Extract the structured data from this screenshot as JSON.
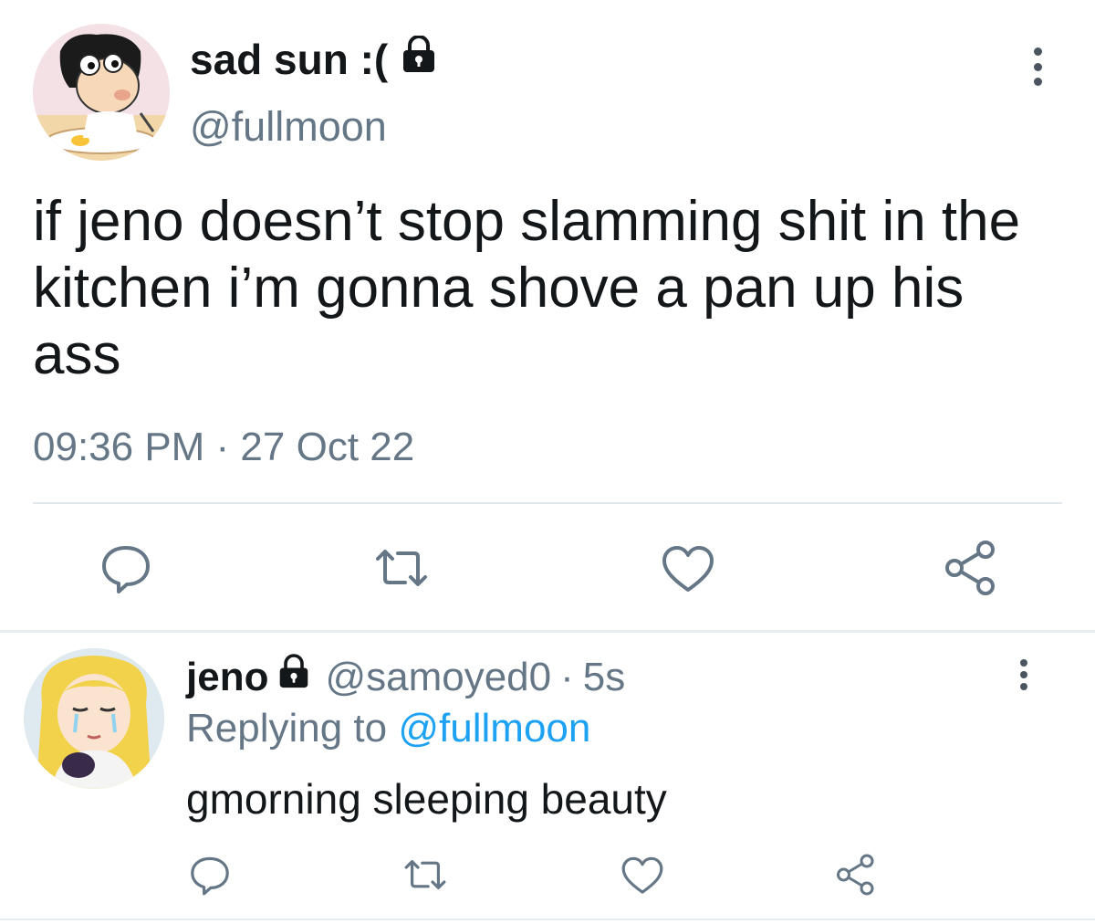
{
  "tweet": {
    "display_name": "sad sun :(",
    "handle": "@fullmoon",
    "text": "if jeno doesn’t stop slamming shit in the kitchen i’m gonna shove a pan up his ass",
    "timestamp": "09:36 PM · 27 Oct 22"
  },
  "reply": {
    "display_name": "jeno",
    "handle": "@samoyed0",
    "separator": "·",
    "time": "5s",
    "replying_prefix": "Replying to",
    "replying_handle": "@fullmoon",
    "text": "gmorning sleeping beauty"
  },
  "icons": {
    "lock": "lock-icon",
    "more": "more-vertical-icon",
    "reply": "reply-icon",
    "retweet": "retweet-icon",
    "like": "heart-icon",
    "share": "share-icon"
  },
  "colors": {
    "text": "#14171a",
    "secondary": "#657786",
    "link": "#1da1f2",
    "icon": "#657786",
    "divider": "#e1e8ed"
  }
}
